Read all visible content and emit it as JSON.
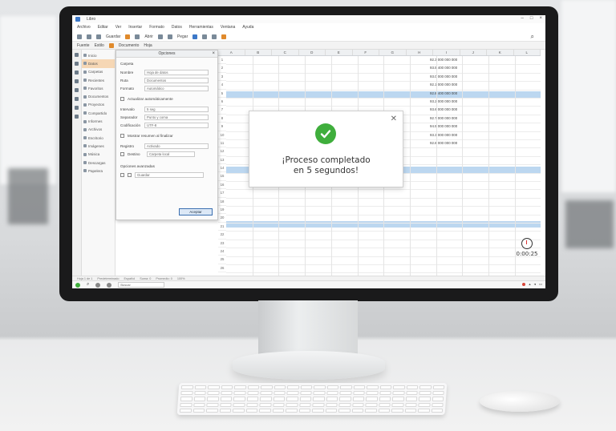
{
  "app": {
    "title": "Libro",
    "menu": [
      "Archivo",
      "Editar",
      "Ver",
      "Insertar",
      "Formato",
      "Datos",
      "Herramientas",
      "Ventana",
      "Ayuda"
    ],
    "toolbar_labels": [
      "Guardar",
      "Abrir",
      "Pegar"
    ],
    "toolbar2_labels": [
      "Fuente",
      "Estilo",
      "Documento",
      "Hoja"
    ]
  },
  "file_tree": {
    "items": [
      "Inicio",
      "Datos",
      "Carpetas",
      "Recientes",
      "Favoritos",
      "Documentos",
      "Proyectos",
      "Compartido",
      "Informes",
      "Archivos",
      "Escritorio",
      "Imágenes",
      "Música",
      "Descargas",
      "Papelera"
    ]
  },
  "settings_dialog": {
    "title": "Opciones",
    "section_title": "Carpeta",
    "fields": [
      {
        "label": "Nombre",
        "value": "Hoja de datos"
      },
      {
        "label": "Ruta",
        "value": "Documentos"
      },
      {
        "label": "Formato",
        "value": "Automático"
      }
    ],
    "checkbox_1": "Actualizar automáticamente",
    "fields2": [
      {
        "label": "Intervalo",
        "value": "5 seg"
      },
      {
        "label": "Separador",
        "value": "Punto y coma"
      },
      {
        "label": "Codificación",
        "value": "UTF-8"
      }
    ],
    "checkbox_2": "Mostrar resumen al finalizar",
    "fields3": [
      {
        "label": "Registro",
        "value": "Activado"
      },
      {
        "label": "Destino",
        "value": "Carpeta local"
      }
    ],
    "option_label": "Opciones avanzadas",
    "option_value": "Guardar",
    "ok_button": "Aceptar"
  },
  "sheet": {
    "columns": [
      "A",
      "B",
      "C",
      "D",
      "E",
      "F",
      "G",
      "H",
      "I",
      "J",
      "K",
      "L"
    ],
    "rows": [
      "1",
      "2",
      "3",
      "4",
      "5",
      "6",
      "7",
      "8",
      "9",
      "10",
      "11",
      "12",
      "13",
      "14",
      "15",
      "16",
      "17",
      "18",
      "19",
      "20",
      "21",
      "22",
      "23",
      "24",
      "25",
      "26"
    ],
    "values": [
      "92.3 000 000 000",
      "93.5 400 000 000",
      "93.0 000 000 000",
      "92.1 000 000 000",
      "92.8 400 000 000",
      "93.2 000 000 000",
      "93.6 000 000 000",
      "92.7 000 000 000",
      "94.5 000 000 000",
      "93.3 000 000 000",
      "92.8 000 000 000"
    ]
  },
  "completion_dialog": {
    "message_line1": "¡Proceso completado",
    "message_line2": "en 5 segundos!"
  },
  "timer": {
    "text": "0:00:25"
  },
  "status_bar": {
    "text": [
      "Hoja 1 de 1",
      "Predeterminado",
      "Español",
      "Suma: 0",
      "Promedio: 0",
      "100%"
    ]
  },
  "taskbar": {
    "search_placeholder": "Buscar"
  },
  "colors": {
    "accent": "#3b6fb0",
    "success": "#3fae3c",
    "highlight_row": "#bcd7f0"
  }
}
